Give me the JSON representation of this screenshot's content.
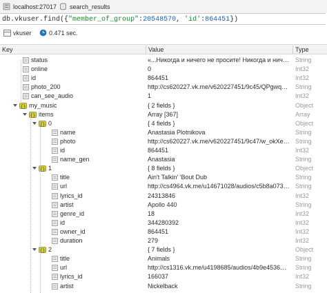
{
  "breadcrumb": {
    "server": "localhost:27017",
    "collection": "search_results"
  },
  "query": {
    "prefix": "db.vkuser.find({",
    "key1": "\"member_of_group\"",
    "colon1": ":",
    "num1": "20548570",
    "sep": ", ",
    "key2": "'id'",
    "colon2": ":",
    "num2": "864451",
    "suffix": "})"
  },
  "info": {
    "collection": "vkuser",
    "time": "0.471 sec."
  },
  "columns": {
    "key": "Key",
    "value": "Value",
    "type": "Type"
  },
  "rows": [
    {
      "key": "status",
      "value": "«...Никогда и ничего не просите! Никогда и ничег...",
      "type": "String"
    },
    {
      "key": "online",
      "value": "0",
      "type": "Int32"
    },
    {
      "key": "id",
      "value": "864451",
      "type": "Int32"
    },
    {
      "key": "photo_200",
      "value": "http://cs620227.vk.me/v620227451/9c45/QPgwq_R9...",
      "type": "String"
    },
    {
      "key": "can_see_audio",
      "value": "1",
      "type": "Int32"
    },
    {
      "key": "my_music",
      "value": "{ 2 fields }",
      "type": "Object"
    },
    {
      "key": "items",
      "value": "Array [367]",
      "type": "Array"
    },
    {
      "key": "0",
      "value": "{ 4 fields }",
      "type": "Object"
    },
    {
      "key": "name",
      "value": "Anastasia Plotnikova",
      "type": "String"
    },
    {
      "key": "photo",
      "value": "http://cs620227.vk.me/v620227451/9c47/w_okXehP...",
      "type": "String"
    },
    {
      "key": "id",
      "value": "864451",
      "type": "Int32"
    },
    {
      "key": "name_gen",
      "value": "Anastasia",
      "type": "String"
    },
    {
      "key": "1",
      "value": "{ 8 fields }",
      "type": "Object"
    },
    {
      "key": "title",
      "value": "Ain't Talkin' 'Bout Dub",
      "type": "String"
    },
    {
      "key": "url",
      "value": "http://cs4964.vk.me/u14671028/audios/c5b8a07352...",
      "type": "String"
    },
    {
      "key": "lyrics_id",
      "value": "24313846",
      "type": "Int32"
    },
    {
      "key": "artist",
      "value": "Apollo 440",
      "type": "String"
    },
    {
      "key": "genre_id",
      "value": "18",
      "type": "Int32"
    },
    {
      "key": "id",
      "value": "344280392",
      "type": "Int32"
    },
    {
      "key": "owner_id",
      "value": "864451",
      "type": "Int32"
    },
    {
      "key": "duration",
      "value": "279",
      "type": "Int32"
    },
    {
      "key": "2",
      "value": "{ 7 fields }",
      "type": "Object"
    },
    {
      "key": "title",
      "value": "Animals",
      "type": "String"
    },
    {
      "key": "url",
      "value": "http://cs1316.vk.me/u4198685/audios/4b9e4536e1b...",
      "type": "String"
    },
    {
      "key": "lyrics_id",
      "value": "166037",
      "type": "Int32"
    },
    {
      "key": "artist",
      "value": "Nickelback",
      "type": "String"
    }
  ],
  "icons": {
    "field": "field-icon",
    "object": "object-icon",
    "expand": "expand-arrow-icon"
  }
}
